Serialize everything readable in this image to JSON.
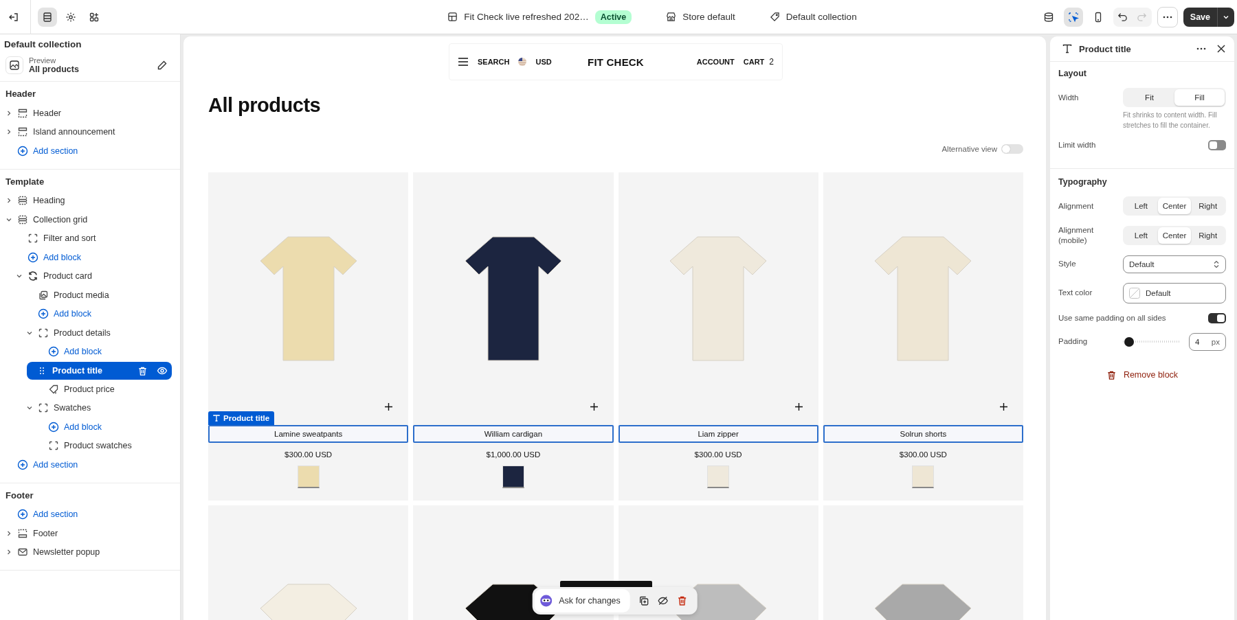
{
  "topbar": {
    "left_tools": [
      {
        "selected": true
      },
      {
        "selected": false
      },
      {
        "selected": false
      }
    ],
    "theme_name": "Fit Check live refreshed 202…",
    "status": "Active",
    "store": "Store default",
    "template": "Default collection",
    "right_tools": [
      {
        "selected": false
      },
      {
        "selected": true
      },
      {
        "selected": false
      }
    ],
    "undo": {
      "disabled": false
    },
    "redo": {
      "disabled": true
    },
    "save": "Save"
  },
  "sidebar": {
    "title": "Default collection",
    "preview_label": "Preview",
    "preview_value": "All products",
    "groups": [
      {
        "title": "Header",
        "items": [
          {
            "kind": "rows",
            "label": "Header",
            "expanded": false,
            "selected": false
          },
          {
            "kind": "rows",
            "label": "Island announcement",
            "expanded": false,
            "selected": false
          },
          {
            "kind": "add",
            "label": "Add section"
          }
        ]
      },
      {
        "title": "Template",
        "items": [
          {
            "kind": "stack",
            "label": "Heading",
            "expanded": false,
            "selected": false
          },
          {
            "kind": "stack",
            "label": "Collection grid",
            "expanded": true,
            "selected": false,
            "children": [
              {
                "kind": "dashed",
                "label": "Filter and sort",
                "selected": false
              },
              {
                "kind": "add",
                "label": "Add block"
              },
              {
                "kind": "cycle",
                "label": "Product card",
                "expanded": true,
                "selected": false,
                "children": [
                  {
                    "kind": "media",
                    "label": "Product media",
                    "selected": false
                  },
                  {
                    "kind": "add",
                    "label": "Add block"
                  },
                  {
                    "kind": "dashed",
                    "label": "Product details",
                    "expanded": true,
                    "selected": false,
                    "children": [
                      {
                        "kind": "add",
                        "label": "Add block"
                      },
                      {
                        "kind": "dashed",
                        "label": "Product title",
                        "selected": true
                      },
                      {
                        "kind": "price",
                        "label": "Product price",
                        "selected": false
                      }
                    ]
                  },
                  {
                    "kind": "dashed",
                    "label": "Swatches",
                    "expanded": true,
                    "selected": false,
                    "children": [
                      {
                        "kind": "add",
                        "label": "Add block"
                      },
                      {
                        "kind": "dashed",
                        "label": "Product swatches",
                        "selected": false
                      }
                    ]
                  }
                ]
              }
            ]
          },
          {
            "kind": "add",
            "label": "Add section"
          }
        ]
      },
      {
        "title": "Footer",
        "items": [
          {
            "kind": "add",
            "label": "Add section"
          },
          {
            "kind": "footer",
            "label": "Footer",
            "expanded": false,
            "selected": false
          },
          {
            "kind": "mail",
            "label": "Newsletter popup",
            "expanded": false,
            "selected": false
          }
        ]
      }
    ]
  },
  "preview": {
    "store_header": {
      "search": "SEARCH",
      "currency": "USD",
      "logo": "FIT CHECK",
      "account": "ACCOUNT",
      "cart": "CART",
      "cart_count": "2"
    },
    "heading": "All products",
    "alt_view": {
      "label": "Alternative view",
      "on": false
    },
    "selection_tag": "Product title",
    "products": [
      {
        "title": "Lamine sweatpants",
        "price": "$300.00 USD",
        "color": "#ecdcae"
      },
      {
        "title": "William cardigan",
        "price": "$1,000.00 USD",
        "color": "#1c2540"
      },
      {
        "title": "Liam zipper",
        "price": "$300.00 USD",
        "color": "#efe9dc"
      },
      {
        "title": "Solrun shorts",
        "price": "$300.00 USD",
        "color": "#eee6d4"
      }
    ],
    "more_products": [
      {
        "color": "#f3eee2"
      },
      {
        "color": "#111111"
      },
      {
        "color": "#bdbdbd"
      },
      {
        "color": "#a9a9a9"
      }
    ]
  },
  "panel": {
    "title": "Product title",
    "groups": [
      {
        "title": "Layout",
        "settings": [
          {
            "kind": "segmented",
            "label": "Width",
            "options": [
              {
                "label": "Fit",
                "selected": false
              },
              {
                "label": "Fill",
                "selected": true
              }
            ],
            "help": "Fit shrinks to content width. Fill stretches to fill the container."
          },
          {
            "kind": "toggle",
            "label": "Limit width",
            "on": false
          }
        ]
      },
      {
        "title": "Typography",
        "settings": [
          {
            "kind": "segmented",
            "label": "Alignment",
            "options": [
              {
                "label": "Left",
                "selected": false
              },
              {
                "label": "Center",
                "selected": true
              },
              {
                "label": "Right",
                "selected": false
              }
            ]
          },
          {
            "kind": "segmented",
            "label": "Alignment (mobile)",
            "options": [
              {
                "label": "Left",
                "selected": false
              },
              {
                "label": "Center",
                "selected": true
              },
              {
                "label": "Right",
                "selected": false
              }
            ]
          },
          {
            "kind": "select",
            "label": "Style",
            "value": "Default"
          },
          {
            "kind": "color",
            "label": "Text color",
            "value": "Default"
          },
          {
            "kind": "toggle",
            "label": "Use same padding on all sides",
            "on": true
          },
          {
            "kind": "slider",
            "label": "Padding",
            "level": 0.03,
            "value": "4",
            "unit": "px"
          }
        ]
      }
    ],
    "remove": "Remove block"
  },
  "assistant": {
    "label": "Ask for changes"
  }
}
